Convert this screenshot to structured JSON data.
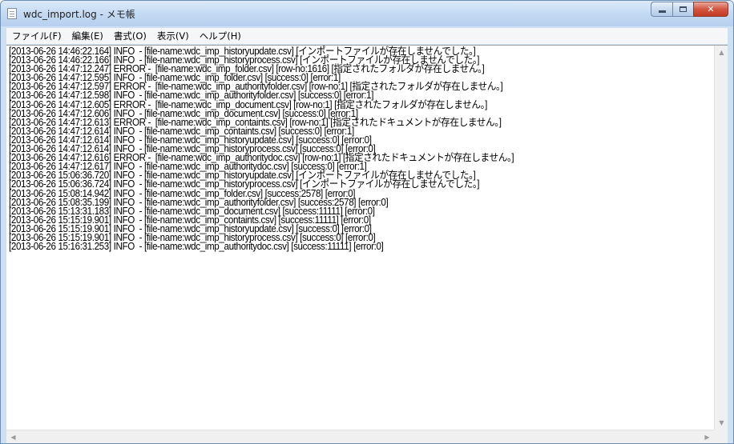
{
  "window": {
    "title": "wdc_import.log - メモ帳",
    "icon": "notepad-icon",
    "buttons": {
      "minimize": "minimize-icon",
      "maximize": "maximize-icon",
      "close": "close-icon",
      "close_glyph": "✕"
    }
  },
  "menu": [
    "ファイル(F)",
    "編集(E)",
    "書式(O)",
    "表示(V)",
    "ヘルプ(H)"
  ],
  "log_lines": [
    "[2013-06-26 14:46:22.164] INFO  - [file-name:wdc_imp_historyupdate.csv] [インポートファイルが存在しませんでした。]",
    "[2013-06-26 14:46:22.166] INFO  - [file-name:wdc_imp_historyprocess.csv] [インポートファイルが存在しませんでした。]",
    "[2013-06-26 14:47:12.247] ERROR -  [file-name:wdc_imp_folder.csv] [row-no:1616] [指定されたフォルダが存在しません。]",
    "[2013-06-26 14:47:12.595] INFO  - [file-name:wdc_imp_folder.csv] [success:0] [error:1]",
    "[2013-06-26 14:47:12.597] ERROR -  [file-name:wdc_imp_authorityfolder.csv] [row-no:1] [指定されたフォルダが存在しません。]",
    "[2013-06-26 14:47:12.598] INFO  - [file-name:wdc_imp_authorityfolder.csv] [success:0] [error:1]",
    "[2013-06-26 14:47:12.605] ERROR -  [file-name:wdc_imp_document.csv] [row-no:1] [指定されたフォルダが存在しません。]",
    "[2013-06-26 14:47:12.606] INFO  - [file-name:wdc_imp_document.csv] [success:0] [error:1]",
    "[2013-06-26 14:47:12.613] ERROR -  [file-name:wdc_imp_containts.csv] [row-no:1] [指定されたドキュメントが存在しません。]",
    "[2013-06-26 14:47:12.614] INFO  - [file-name:wdc_imp_containts.csv] [success:0] [error:1]",
    "[2013-06-26 14:47:12.614] INFO  - [file-name:wdc_imp_historyupdate.csv] [success:0] [error:0]",
    "[2013-06-26 14:47:12.614] INFO  - [file-name:wdc_imp_historyprocess.csv] [success:0] [error:0]",
    "[2013-06-26 14:47:12.616] ERROR -  [file-name:wdc_imp_authoritydoc.csv] [row-no:1] [指定されたドキュメントが存在しません。]",
    "[2013-06-26 14:47:12.617] INFO  - [file-name:wdc_imp_authoritydoc.csv] [success:0] [error:1]",
    "[2013-06-26 15:06:36.720] INFO  - [file-name:wdc_imp_historyupdate.csv] [インポートファイルが存在しませんでした。]",
    "[2013-06-26 15:06:36.724] INFO  - [file-name:wdc_imp_historyprocess.csv] [インポートファイルが存在しませんでした。]",
    "[2013-06-26 15:08:14.942] INFO  - [file-name:wdc_imp_folder.csv] [success:2578] [error:0]",
    "[2013-06-26 15:08:35.199] INFO  - [file-name:wdc_imp_authorityfolder.csv] [success:2578] [error:0]",
    "[2013-06-26 15:13:31.183] INFO  - [file-name:wdc_imp_document.csv] [success:11111] [error:0]",
    "[2013-06-26 15:15:19.901] INFO  - [file-name:wdc_imp_containts.csv] [success:11111] [error:0]",
    "[2013-06-26 15:15:19.901] INFO  - [file-name:wdc_imp_historyupdate.csv] [success:0] [error:0]",
    "[2013-06-26 15:15:19.901] INFO  - [file-name:wdc_imp_historyprocess.csv] [success:0] [error:0]",
    "[2013-06-26 15:16:31.253] INFO  - [file-name:wdc_imp_authoritydoc.csv] [success:11111] [error:0]"
  ],
  "scrollbars": {
    "up": "▲",
    "down": "▼",
    "left": "◀",
    "right": "▶"
  }
}
